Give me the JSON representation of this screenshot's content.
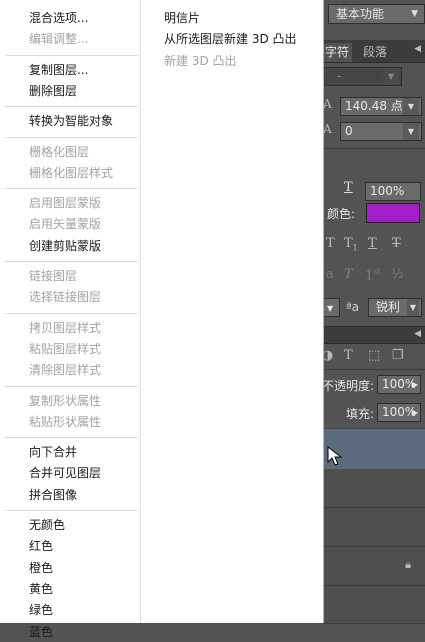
{
  "workspace": {
    "label": "基本功能"
  },
  "character_panel": {
    "tabs": [
      {
        "label": "字符"
      },
      {
        "label": "段落"
      }
    ],
    "font_size": "140.48 点",
    "leading": "0",
    "scale": "100%",
    "color_label": "颜色:",
    "color": "#a31ec9",
    "antialias_prefix": "ªa",
    "antialias": "锐利"
  },
  "layers_panel": {
    "opacity_label": "不透明度:",
    "opacity": "100%",
    "fill_label": "填充:",
    "fill": "100%"
  },
  "menu": {
    "col1_groups": [
      [
        {
          "label": "混合选项...",
          "enabled": true
        },
        {
          "label": "编辑调整...",
          "enabled": false
        }
      ],
      [
        {
          "label": "复制图层...",
          "enabled": true
        },
        {
          "label": "删除图层",
          "enabled": true
        }
      ],
      [
        {
          "label": "转换为智能对象",
          "enabled": true
        }
      ],
      [
        {
          "label": "栅格化图层",
          "enabled": false
        },
        {
          "label": "栅格化图层样式",
          "enabled": false
        }
      ],
      [
        {
          "label": "启用图层蒙版",
          "enabled": false
        },
        {
          "label": "启用矢量蒙版",
          "enabled": false
        },
        {
          "label": "创建剪贴蒙版",
          "enabled": true
        }
      ],
      [
        {
          "label": "链接图层",
          "enabled": false
        },
        {
          "label": "选择链接图层",
          "enabled": false
        }
      ],
      [
        {
          "label": "拷贝图层样式",
          "enabled": false
        },
        {
          "label": "粘贴图层样式",
          "enabled": false
        },
        {
          "label": "清除图层样式",
          "enabled": false
        }
      ],
      [
        {
          "label": "复制形状属性",
          "enabled": false
        },
        {
          "label": "粘贴形状属性",
          "enabled": false
        }
      ],
      [
        {
          "label": "向下合并",
          "enabled": true
        },
        {
          "label": "合并可见图层",
          "enabled": true
        },
        {
          "label": "拼合图像",
          "enabled": true
        }
      ],
      [
        {
          "label": "无颜色",
          "enabled": true
        },
        {
          "label": "红色",
          "enabled": true
        },
        {
          "label": "橙色",
          "enabled": true
        },
        {
          "label": "黄色",
          "enabled": true
        },
        {
          "label": "绿色",
          "enabled": true
        },
        {
          "label": "蓝色",
          "enabled": true
        }
      ]
    ],
    "col2_items": [
      {
        "label": "明信片",
        "enabled": true
      },
      {
        "label": "从所选图层新建 3D 凸出",
        "enabled": true
      },
      {
        "label": "新建 3D 凸出",
        "enabled": false
      }
    ]
  }
}
